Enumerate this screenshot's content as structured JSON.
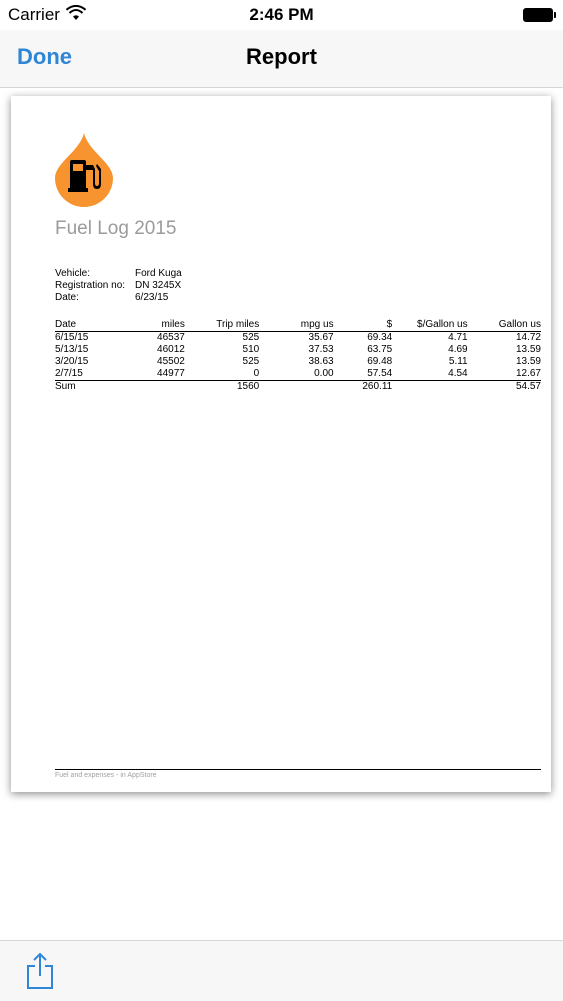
{
  "status": {
    "carrier": "Carrier",
    "time": "2:46 PM"
  },
  "nav": {
    "done": "Done",
    "title": "Report"
  },
  "report": {
    "title": "Fuel Log 2015",
    "meta": [
      {
        "key": "Vehicle:",
        "value": "Ford Kuga"
      },
      {
        "key": "Registration no:",
        "value": "DN 3245X"
      },
      {
        "key": "Date:",
        "value": "6/23/15"
      }
    ],
    "columns": [
      "Date",
      "miles",
      "Trip miles",
      "mpg us",
      "$",
      "$/Gallon us",
      "Gallon us"
    ],
    "rows": [
      [
        "6/15/15",
        "46537",
        "525",
        "35.67",
        "69.34",
        "4.71",
        "14.72"
      ],
      [
        "5/13/15",
        "46012",
        "510",
        "37.53",
        "63.75",
        "4.69",
        "13.59"
      ],
      [
        "3/20/15",
        "45502",
        "525",
        "38.63",
        "69.48",
        "5.11",
        "13.59"
      ],
      [
        "2/7/15",
        "44977",
        "0",
        "0.00",
        "57.54",
        "4.54",
        "12.67"
      ]
    ],
    "sum": [
      "Sum",
      "",
      "1560",
      "",
      "260.11",
      "",
      "54.57"
    ],
    "footer": "Fuel and expenses - in AppStore"
  },
  "colors": {
    "accent": "#2f86d6",
    "logo": "#f7942f",
    "title_gray": "#9b9b9b"
  },
  "icons": {
    "logo": "fuel-drop-logo",
    "share": "share-icon"
  }
}
